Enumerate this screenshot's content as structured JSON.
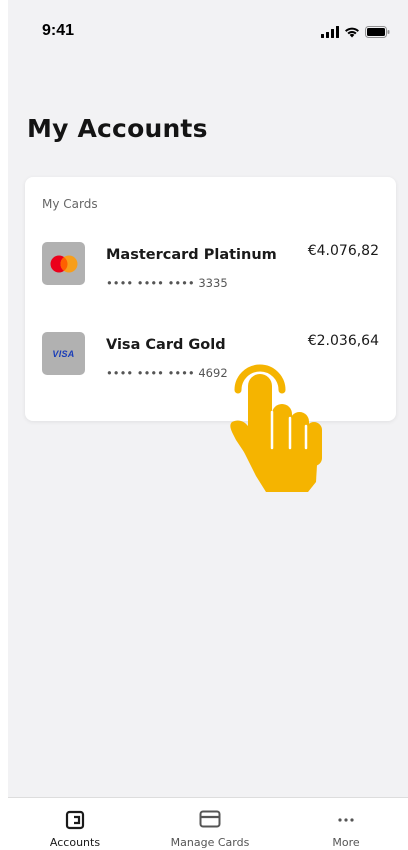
{
  "status_bar": {
    "time": "9:41"
  },
  "page": {
    "title": "My Accounts"
  },
  "cards_section": {
    "label": "My Cards",
    "cards": [
      {
        "name": "Mastercard Platinum",
        "number": "•••• •••• •••• 3335",
        "balance": "€4.076,82",
        "brand": "mastercard"
      },
      {
        "name": "Visa Card Gold",
        "number": "•••• •••• •••• 4692",
        "balance": "€2.036,64",
        "brand": "visa",
        "brand_text": "VISA"
      }
    ]
  },
  "tab_bar": {
    "tabs": [
      {
        "label": "Accounts",
        "icon": "wallet-icon",
        "active": true
      },
      {
        "label": "Manage Cards",
        "icon": "credit-card-icon",
        "active": false
      },
      {
        "label": "More",
        "icon": "more-dots-icon",
        "active": false
      }
    ]
  },
  "colors": {
    "background": "#f2f2f4",
    "card_surface": "#ffffff",
    "thumb_gray": "#b1b1b1",
    "tap_hand": "#f5b400",
    "mastercard_red": "#eb001b",
    "mastercard_orange": "#f79e1b",
    "visa_blue": "#1a3db8"
  }
}
